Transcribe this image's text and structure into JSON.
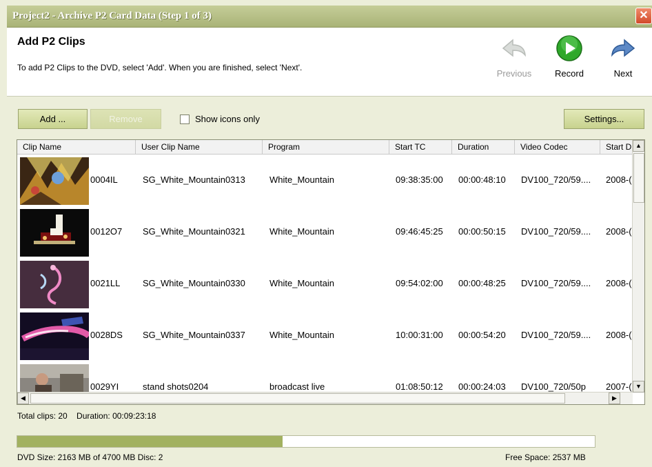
{
  "window": {
    "title": "Project2 - Archive P2 Card Data (Step 1 of 3)",
    "close_glyph": "✕"
  },
  "header": {
    "title": "Add P2 Clips",
    "description": "To add P2 Clips to the DVD, select 'Add'. When you are finished, select 'Next'.",
    "previous_label": "Previous",
    "record_label": "Record",
    "next_label": "Next"
  },
  "toolbar": {
    "add_label": "Add ...",
    "remove_label": "Remove",
    "show_icons_label": "Show icons only",
    "show_icons_checked": false,
    "settings_label": "Settings..."
  },
  "table": {
    "columns": [
      "Clip Name",
      "User Clip Name",
      "Program",
      "Start TC",
      "Duration",
      "Video Codec",
      "Start D"
    ],
    "rows": [
      {
        "clip": "0004IL",
        "user": "SG_White_Mountain0313",
        "program": "White_Mountain",
        "start_tc": "09:38:35:00",
        "duration": "00:00:48:10",
        "codec": "DV100_720/59....",
        "start_date": "2008-("
      },
      {
        "clip": "0012O7",
        "user": "SG_White_Mountain0321",
        "program": "White_Mountain",
        "start_tc": "09:46:45:25",
        "duration": "00:00:50:15",
        "codec": "DV100_720/59....",
        "start_date": "2008-("
      },
      {
        "clip": "0021LL",
        "user": "SG_White_Mountain0330",
        "program": "White_Mountain",
        "start_tc": "09:54:02:00",
        "duration": "00:00:48:25",
        "codec": "DV100_720/59....",
        "start_date": "2008-("
      },
      {
        "clip": "0028DS",
        "user": "SG_White_Mountain0337",
        "program": "White_Mountain",
        "start_tc": "10:00:31:00",
        "duration": "00:00:54:20",
        "codec": "DV100_720/59....",
        "start_date": "2008-("
      },
      {
        "clip": "0029YI",
        "user": "stand shots0204",
        "program": "broadcast live",
        "start_tc": "01:08:50:12",
        "duration": "00:00:24:03",
        "codec": "DV100_720/50p",
        "start_date": "2007-("
      }
    ]
  },
  "footer": {
    "total_clips": "Total clips: 20",
    "duration": "Duration: 00:09:23:18",
    "dvd_size": "DVD Size: 2163 MB of 4700 MB Disc: 2",
    "free_space": "Free Space: 2537 MB",
    "progress_fraction": 0.46
  },
  "colors": {
    "titlebar": "#b3bc80",
    "accent": "#a2b160",
    "record_green": "#2fa82a"
  }
}
